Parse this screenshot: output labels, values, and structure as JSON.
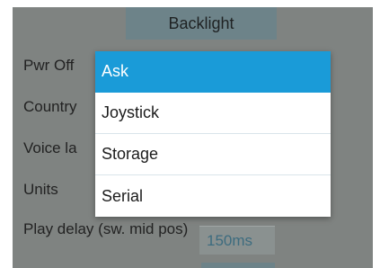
{
  "header": {
    "title": "Backlight"
  },
  "rows": [
    {
      "label": "Pwr Off"
    },
    {
      "label": "Country"
    },
    {
      "label": "Voice la"
    },
    {
      "label": "Units"
    },
    {
      "label": "Play delay (sw. mid pos)",
      "value": "150ms"
    }
  ],
  "dropdown": {
    "options": [
      {
        "label": "Ask",
        "selected": true
      },
      {
        "label": "Joystick",
        "selected": false
      },
      {
        "label": "Storage",
        "selected": false
      },
      {
        "label": "Serial",
        "selected": false
      }
    ]
  },
  "colors": {
    "panel_bg": "#7f8381",
    "header_bg": "#6d8389",
    "selected_bg": "#1a9bd8",
    "value_text": "#3d6c7f"
  }
}
